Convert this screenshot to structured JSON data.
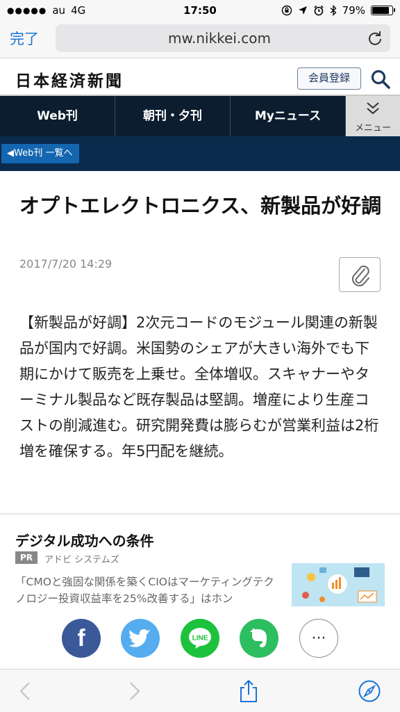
{
  "status_bar": {
    "carrier": "au",
    "network": "4G",
    "time": "17:50",
    "battery": "79%",
    "battery_fraction": 0.79
  },
  "browser": {
    "done_label": "完了",
    "url": "mw.nikkei.com"
  },
  "site_header": {
    "logo_text": "日本経済新聞",
    "register_label": "会員登録"
  },
  "nav": {
    "tabs": [
      "Web刊",
      "朝刊・夕刊",
      "Myニュース"
    ],
    "menu_label": "メニュー"
  },
  "breadcrumb": {
    "back_label": "Web刊 一覧へ"
  },
  "article": {
    "headline": "オプトエレクトロニクス、新製品が好調",
    "date": "2017/7/20 14:29",
    "body": "【新製品が好調】2次元コードのモジュール関連の新製品が国内で好調。米国勢のシェアが大きい海外でも下期にかけて販売を上乗せ。全体増収。スキャナーやターミナル製品など既存製品は堅調。増産により生産コストの削減進む。研究開発費は膨らむが営業利益は2桁増を確保する。年5円配を継続。"
  },
  "ad": {
    "title": "デジタル成功への条件",
    "pr_label": "PR",
    "advertiser": "アドビ システムズ",
    "text": "「CMOと強固な関係を築くCIOはマーケティングテクノロジー投資収益率を25%改善する」はホン"
  },
  "share": {
    "facebook_glyph": "f",
    "line_label": "LINE",
    "more_glyph": "···",
    "colors": {
      "facebook": "#3b5998",
      "twitter": "#55acee",
      "line": "#1dc23c",
      "evernote": "#2dbe60"
    }
  },
  "colors": {
    "nav_bg": "#0b1d2e",
    "strip_bg": "#0a2b4c",
    "accent_blue": "#1a73d9"
  }
}
